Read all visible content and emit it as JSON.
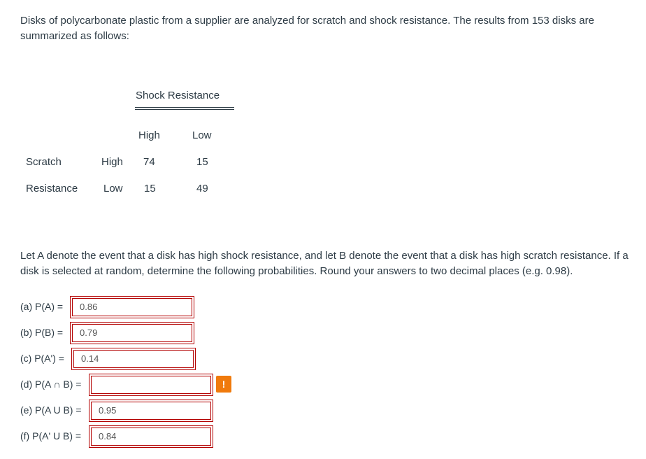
{
  "intro": "Disks of polycarbonate plastic from a supplier are analyzed for scratch and shock resistance. The results from 153 disks are summarized as follows:",
  "table": {
    "column_group": "Shock  Resistance",
    "col_high": "High",
    "col_low": "Low",
    "row_group_1": "Scratch",
    "row_group_2": "Resistance",
    "row_high": "High",
    "row_low": "Low",
    "cells": {
      "high_high": "74",
      "high_low": "15",
      "low_high": "15",
      "low_low": "49"
    }
  },
  "question": "Let A denote the event that a disk has high shock resistance, and let B denote the event that a disk has high scratch resistance. If a disk is selected at random, determine the following probabilities. Round your answers to two decimal places (e.g. 0.98).",
  "answers": [
    {
      "label": "(a) P(A) =",
      "value": "0.86"
    },
    {
      "label": "(b) P(B) =",
      "value": "0.79"
    },
    {
      "label": "(c) P(A') =",
      "value": "0.14"
    },
    {
      "label": "(d) P(A ∩ B) =",
      "value": ""
    },
    {
      "label": "(e) P(A U B) =",
      "value": "0.95"
    },
    {
      "label": "(f) P(A' U B) =",
      "value": "0.84"
    }
  ],
  "alert_symbol": "!",
  "colors": {
    "text": "#2d3b45",
    "field_border": "#b30000",
    "alert": "#f07a0c"
  }
}
